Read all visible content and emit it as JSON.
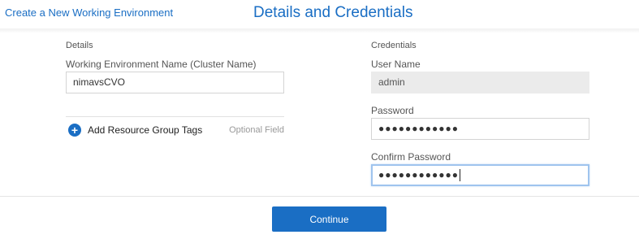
{
  "header": {
    "back_link": "Create a New Working Environment",
    "title": "Details and Credentials"
  },
  "details": {
    "section_label": "Details",
    "cluster_name_label": "Working Environment Name (Cluster Name)",
    "cluster_name_value": "nimavsCVO",
    "add_tags_label": "Add Resource Group Tags",
    "optional_label": "Optional Field"
  },
  "credentials": {
    "section_label": "Credentials",
    "username_label": "User Name",
    "username_value": "admin",
    "password_label": "Password",
    "password_mask": "●●●●●●●●●●●●",
    "confirm_label": "Confirm Password",
    "confirm_mask": "●●●●●●●●●●●●"
  },
  "footer": {
    "continue_label": "Continue"
  },
  "colors": {
    "accent": "#1a6ec4",
    "readonly_bg": "#ebebeb",
    "focus_border": "#9fc4ee"
  },
  "icons": {
    "add_tags": "plus-circle-icon"
  }
}
